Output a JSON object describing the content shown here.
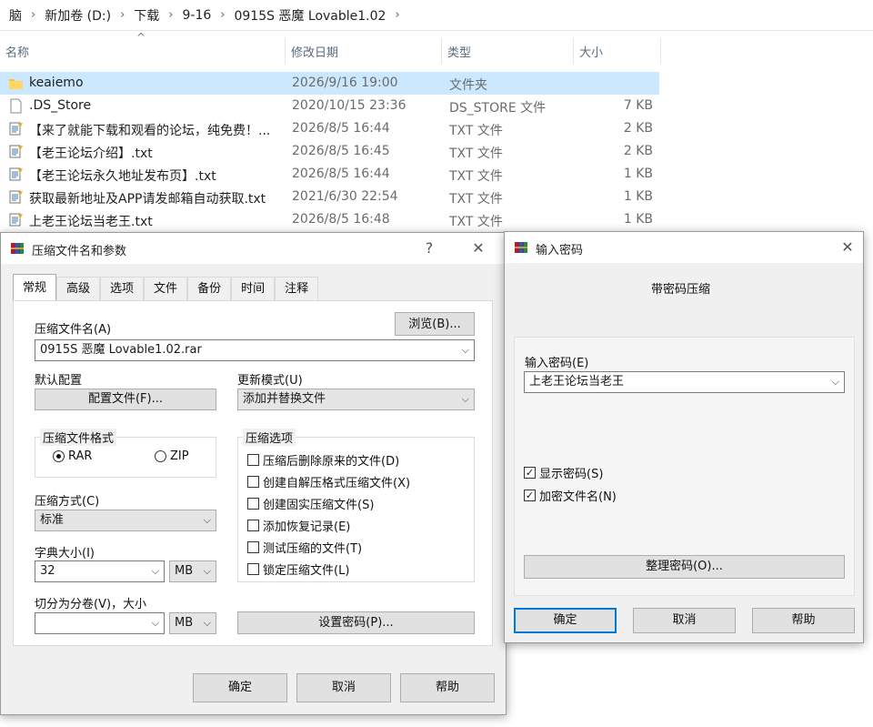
{
  "explorer": {
    "breadcrumb": [
      "脑",
      "新加卷 (D:)",
      "下载",
      "9-16",
      "0915S 恶魔 Lovable1.02"
    ],
    "columns": {
      "name": "名称",
      "date": "修改日期",
      "type": "类型",
      "size": "大小"
    },
    "files": [
      {
        "name": "keaiemo",
        "date": "2026/9/16 19:00",
        "type": "文件夹",
        "size": "",
        "icon": "folder-icon",
        "selected": true
      },
      {
        "name": ".DS_Store",
        "date": "2020/10/15 23:36",
        "type": "DS_STORE 文件",
        "size": "7 KB",
        "icon": "file-icon"
      },
      {
        "name": "【来了就能下载和观看的论坛，纯免费！...",
        "date": "2026/8/5 16:44",
        "type": "TXT 文件",
        "size": "2 KB",
        "icon": "text-file-icon"
      },
      {
        "name": "【老王论坛介绍】.txt",
        "date": "2026/8/5 16:45",
        "type": "TXT 文件",
        "size": "2 KB",
        "icon": "text-file-icon"
      },
      {
        "name": "【老王论坛永久地址发布页】.txt",
        "date": "2026/8/5 16:44",
        "type": "TXT 文件",
        "size": "1 KB",
        "icon": "text-file-icon"
      },
      {
        "name": "获取最新地址及APP请发邮箱自动获取.txt",
        "date": "2021/6/30 22:54",
        "type": "TXT 文件",
        "size": "1 KB",
        "icon": "text-file-icon"
      },
      {
        "name": "上老王论坛当老王.txt",
        "date": "2026/8/5 16:48",
        "type": "TXT 文件",
        "size": "1 KB",
        "icon": "text-file-icon"
      }
    ]
  },
  "archive_dialog": {
    "title": "压缩文件名和参数",
    "help": "?",
    "close": "✕",
    "tabs": [
      "常规",
      "高级",
      "选项",
      "文件",
      "备份",
      "时间",
      "注释"
    ],
    "archive_name_label": "压缩文件名(A)",
    "browse_label": "浏览(B)...",
    "archive_name_value": "0915S 恶魔 Lovable1.02.rar",
    "default_profile_label": "默认配置",
    "profiles_label": "配置文件(F)...",
    "update_mode_label": "更新模式(U)",
    "update_mode_value": "添加并替换文件",
    "format_group_label": "压缩文件格式",
    "format_rar": "RAR",
    "format_zip": "ZIP",
    "options_group_label": "压缩选项",
    "options": [
      "压缩后删除原来的文件(D)",
      "创建自解压格式压缩文件(X)",
      "创建固实压缩文件(S)",
      "添加恢复记录(E)",
      "测试压缩的文件(T)",
      "锁定压缩文件(L)"
    ],
    "method_label": "压缩方式(C)",
    "method_value": "标准",
    "dict_label": "字典大小(I)",
    "dict_value": "32",
    "dict_unit": "MB",
    "split_label": "切分为分卷(V)，大小",
    "split_value": "",
    "split_unit": "MB",
    "set_password_label": "设置密码(P)...",
    "ok": "确定",
    "cancel": "取消",
    "help_button": "帮助"
  },
  "password_dialog": {
    "title": "输入密码",
    "close": "✕",
    "heading": "带密码压缩",
    "password_label": "输入密码(E)",
    "password_value": "上老王论坛当老王",
    "show_password": "显示密码(S)",
    "encrypt_names": "加密文件名(N)",
    "organize_label": "整理密码(O)...",
    "ok": "确定",
    "cancel": "取消",
    "help_button": "帮助"
  }
}
